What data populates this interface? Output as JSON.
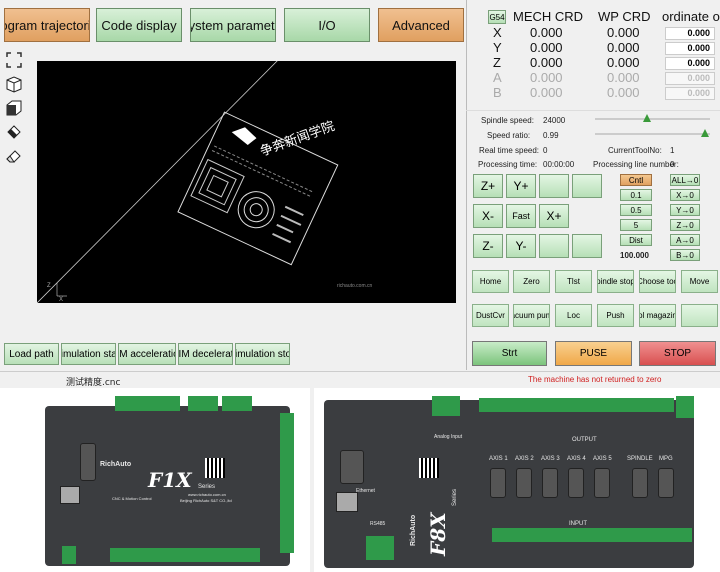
{
  "tabs": [
    {
      "label": "rogram trajectorie",
      "style": "orange"
    },
    {
      "label": "Code display",
      "style": "green"
    },
    {
      "label": "System parameter",
      "style": "green"
    },
    {
      "label": "I/O",
      "style": "green"
    },
    {
      "label": "Advanced",
      "style": "orange"
    }
  ],
  "toolbar_icons": [
    "fit-view-icon",
    "iso-view-icon",
    "cube-view-icon",
    "paint-icon",
    "eraser-icon"
  ],
  "viewport": {
    "watermark": "richauto.com.cn",
    "artwork_text": "争奔新闻学院"
  },
  "sim_buttons": [
    "Load path",
    "Simulation start",
    "SIM acceleration",
    "SIM decelerate",
    "Simulation stop"
  ],
  "coords": {
    "coord_system": "G54",
    "headers": {
      "mech": "MECH CRD",
      "wp": "WP CRD",
      "offset": "ordinate off"
    },
    "axes": [
      {
        "name": "X",
        "mech": "0.000",
        "wp": "0.000",
        "offset": "0.000",
        "active": true
      },
      {
        "name": "Y",
        "mech": "0.000",
        "wp": "0.000",
        "offset": "0.000",
        "active": true
      },
      {
        "name": "Z",
        "mech": "0.000",
        "wp": "0.000",
        "offset": "0.000",
        "active": true
      },
      {
        "name": "A",
        "mech": "0.000",
        "wp": "0.000",
        "offset": "0.000",
        "active": false
      },
      {
        "name": "B",
        "mech": "0.000",
        "wp": "0.000",
        "offset": "0.000",
        "active": false
      }
    ]
  },
  "status": {
    "spindle_speed_label": "Spindle speed:",
    "spindle_speed": "24000",
    "speed_ratio_label": "Speed ratio:",
    "speed_ratio": "0.99",
    "realtime_speed_label": "Real time speed:",
    "realtime_speed": "0",
    "current_tool_label": "CurrentToolNo:",
    "current_tool": "1",
    "processing_time_label": "Processing time:",
    "processing_time": "00:00:00",
    "processing_line_label": "Processing line number:",
    "processing_line": "0"
  },
  "jog": {
    "row1": [
      "Z+",
      "Y+",
      "",
      ""
    ],
    "row2": [
      "X-",
      "Fast",
      "X+"
    ],
    "row3": [
      "Z-",
      "Y-",
      "",
      ""
    ]
  },
  "step": [
    "Cntl",
    "0.1",
    "0.5",
    "5",
    "Dist"
  ],
  "step_value": "100.000",
  "zero": [
    "ALL→0",
    "X→0",
    "Y→0",
    "Z→0",
    "A→0",
    "B→0"
  ],
  "func_row1": [
    "Home",
    "Zero",
    "Tlst",
    "pindle stop",
    "Choose too",
    "Move"
  ],
  "func_row2": [
    "DustCvr",
    "acuum pum",
    "Loc",
    "Push",
    "ol magazin",
    ""
  ],
  "big_buttons": {
    "start": "Strt",
    "pause": "PUSE",
    "stop": "STOP"
  },
  "filename": "测试精度.cnc",
  "alarm": "The machine has not returned to zero",
  "colors": {
    "green": "#a8d8a8",
    "orange": "#e0a060",
    "alarm": "#d02020",
    "stop": "#e06060",
    "pause": "#f0b050"
  },
  "products": {
    "left": {
      "brand": "RichAuto",
      "model": "F1X",
      "series": "Series",
      "subtitle": "CNC & Motion Control",
      "address": "Beijing RichAuto S&T CO.,ltd",
      "web": "www.richauto.com.cn"
    },
    "right": {
      "brand": "RichAuto",
      "model": "F8X",
      "series": "Series",
      "port_ethernet": "Ethernet",
      "port_rs485": "RS485",
      "output_label": "OUTPUT",
      "input_label": "INPUT",
      "analog_input": "Analog Input",
      "axes": [
        "AXIS 1",
        "AXIS 2",
        "AXIS 3",
        "AXIS 4",
        "AXIS 5",
        "SPINDLE",
        "MPG"
      ]
    }
  }
}
